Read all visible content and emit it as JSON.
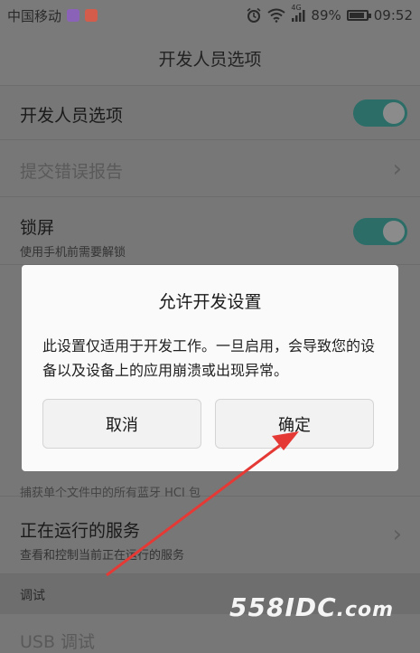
{
  "status_bar": {
    "carrier": "中国移动",
    "signal_type": "4G",
    "battery_percent": "89%",
    "battery_level": 0.89,
    "time": "09:52",
    "icons": [
      "gallery-notify-icon",
      "app-notify-icon",
      "alarm-icon",
      "wifi-icon",
      "cell-signal-icon",
      "battery-icon"
    ]
  },
  "header": {
    "title": "开发人员选项"
  },
  "settings": {
    "dev_options": {
      "label": "开发人员选项",
      "enabled": true
    },
    "bug_report": {
      "label": "提交错误报告"
    },
    "lock_screen": {
      "label": "锁屏",
      "sub": "使用手机前需要解锁",
      "enabled": true
    },
    "hci_snoop": {
      "sub": "捕获单个文件中的所有蓝牙 HCI 包"
    },
    "running_services": {
      "label": "正在运行的服务",
      "sub": "查看和控制当前正在运行的服务"
    },
    "debug_section": {
      "label": "调试"
    },
    "usb_debug": {
      "label": "USB 调试"
    }
  },
  "dialog": {
    "title": "允许开发设置",
    "message": "此设置仅适用于开发工作。一旦启用，会导致您的设备以及设备上的应用崩溃或出现异常。",
    "cancel_label": "取消",
    "confirm_label": "确定"
  },
  "watermark": {
    "main": "558IDC",
    "suffix": ".com"
  },
  "colors": {
    "toggle_on": "#2c6d68",
    "annotation_arrow": "#e53935",
    "dialog_bg": "#fafafa"
  }
}
